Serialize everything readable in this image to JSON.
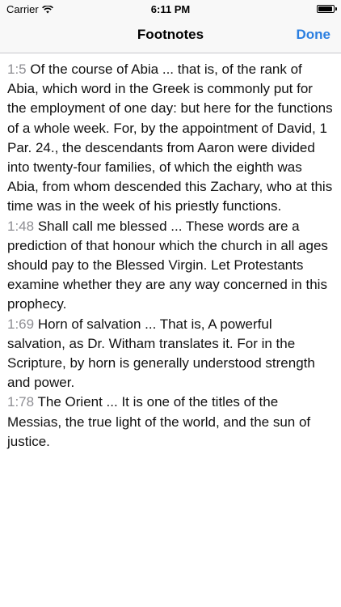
{
  "status_bar": {
    "carrier": "Carrier",
    "time": "6:11 PM",
    "wifi_icon": "wifi-icon",
    "battery_icon": "battery-icon"
  },
  "nav": {
    "title": "Footnotes",
    "done_label": "Done"
  },
  "colors": {
    "accent": "#2b7fe0",
    "reference": "#8e8e93"
  },
  "footnotes": [
    {
      "ref": "1:5",
      "text": "Of the course of Abia ... that is, of the rank of Abia, which word in the Greek is commonly put for the employment of one day: but here for the functions of a whole week. For, by the appointment of David, 1 Par. 24., the descendants from Aaron were divided into twenty-four families, of which the eighth was Abia, from whom descended this Zachary, who at this time was in the week of his priestly functions."
    },
    {
      "ref": "1:48",
      "text": "Shall call me blessed ... These words are a prediction of that honour which the church in all ages should pay to the Blessed Virgin. Let Protestants examine whether they are any way concerned in this prophecy."
    },
    {
      "ref": "1:69",
      "text": "Horn of salvation ... That is, A powerful salvation, as Dr. Witham translates it. For in the Scripture, by horn is generally understood strength and power."
    },
    {
      "ref": "1:78",
      "text": "The Orient ... It is one of the titles of the Messias, the true light of the world, and the sun of justice."
    }
  ]
}
